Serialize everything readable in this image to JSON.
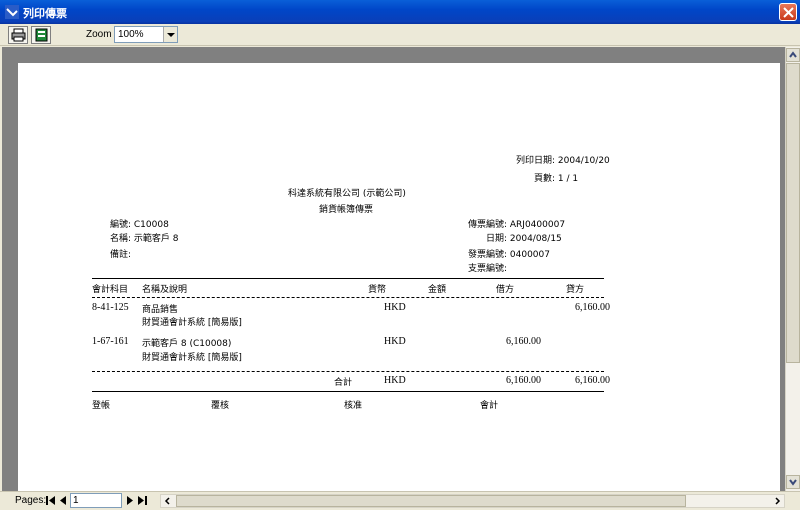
{
  "window": {
    "title": "列印傳票"
  },
  "toolbar": {
    "zoom_label": "Zoom",
    "zoom_value": "100%"
  },
  "report": {
    "print_date": "列印日期: 2004/10/20",
    "page_count": "頁數: 1 / 1",
    "company": "科達系統有限公司 (示範公司)",
    "doc_title": "銷貨帳簿傳票",
    "left": {
      "code": "編號: C10008",
      "name": "名稱: 示範客戶 8",
      "remark": "備註:"
    },
    "right": {
      "voucher_no": "傳票編號: ARJ0400007",
      "date": "日期: 2004/08/15",
      "invoice_no": "發票編號: 0400007",
      "cheque_no": "支票編號:"
    },
    "columns": [
      "會計科目",
      "名稱及說明",
      "貨幣",
      "金額",
      "借方",
      "貸方"
    ],
    "rows": [
      {
        "account": "8-41-125",
        "name": "商品銷售",
        "desc": "財貿通會計系統 [簡易版]",
        "currency": "HKD",
        "debit": "",
        "credit": "6,160.00"
      },
      {
        "account": "1-67-161",
        "name": "示範客戶 8 (C10008)",
        "desc": "財貿通會計系統 [簡易版]",
        "currency": "HKD",
        "debit": "6,160.00",
        "credit": ""
      }
    ],
    "total": {
      "label": "合計",
      "currency": "HKD",
      "debit": "6,160.00",
      "credit": "6,160.00"
    },
    "signatures": [
      "登帳",
      "覆核",
      "核准",
      "會計"
    ]
  },
  "status": {
    "pages_label": "Pages:",
    "page_value": "1"
  }
}
